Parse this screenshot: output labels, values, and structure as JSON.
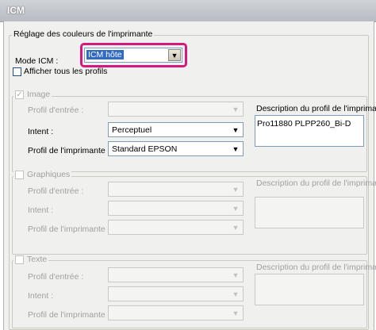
{
  "window": {
    "title": "ICM"
  },
  "group": {
    "title": "Réglage des couleurs de l'imprimante"
  },
  "mode": {
    "label": "Mode ICM :",
    "value": "ICM hôte"
  },
  "show_all": {
    "label": "Afficher tous les profils",
    "checked": false
  },
  "image": {
    "title": "Image",
    "checked": true,
    "input_profile_label": "Profil d'entrée :",
    "input_profile_value": "",
    "intent_label": "Intent :",
    "intent_value": "Perceptuel",
    "printer_profile_label": "Profil de l'imprimante :",
    "printer_profile_value": "Standard EPSON",
    "desc_label": "Description du profil de l'imprimante",
    "desc_value": "Pro11880 PLPP260_Bi-D"
  },
  "graphics": {
    "title": "Graphiques",
    "checked": false,
    "input_profile_label": "Profil d'entrée :",
    "intent_label": "Intent :",
    "printer_profile_label": "Profil de l'imprimante :",
    "desc_label": "Description du profil de l'imprimante"
  },
  "text": {
    "title": "Texte",
    "checked": false,
    "input_profile_label": "Profil d'entrée :",
    "intent_label": "Intent :",
    "printer_profile_label": "Profil de l'imprimante :",
    "desc_label": "Description du profil de l'imprimante"
  },
  "icons": {
    "dropdown": "chevron-down-icon",
    "check": "checkmark-icon"
  },
  "colors": {
    "highlight": "#d4187e",
    "selection": "#316ac5"
  }
}
